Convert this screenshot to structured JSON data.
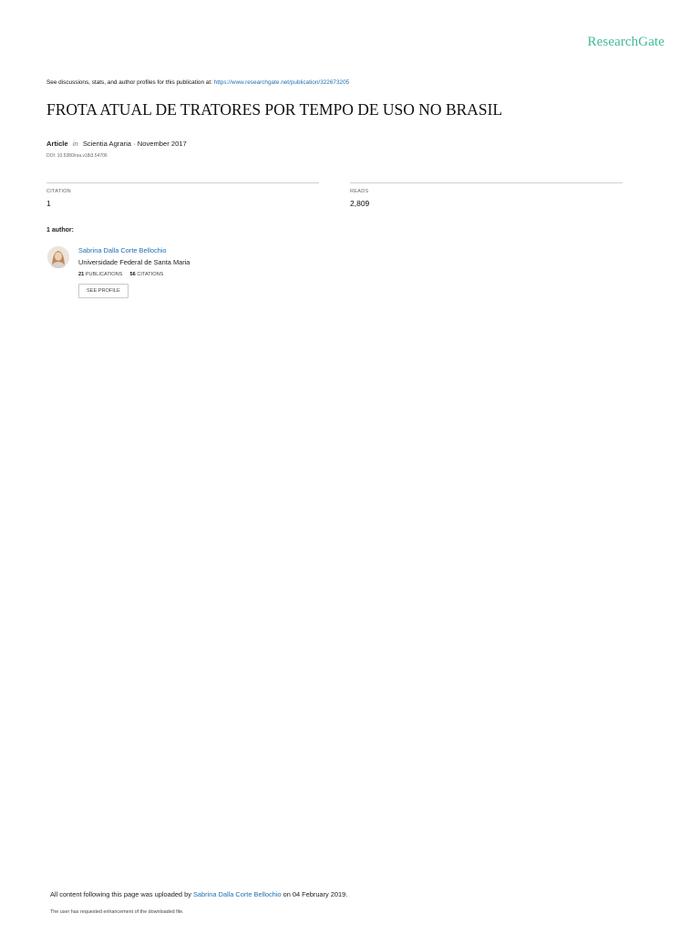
{
  "colors": {
    "brand": "#40ba9b",
    "link": "#1f6fb2"
  },
  "header": {
    "brand": "ResearchGate"
  },
  "notice": {
    "text": "See discussions, stats, and author profiles for this publication at:",
    "url": "https://www.researchgate.net/publication/322673205"
  },
  "article": {
    "title": "FROTA ATUAL DE TRATORES POR TEMPO DE USO NO BRASIL",
    "type": "Article",
    "in_label": "in",
    "journal_date": "Scientia Agraria · November 2017",
    "doi": "DOI: 10.5380/rsa.v18i3.54706"
  },
  "stats": {
    "citation_label": "CITATION",
    "citation_value": "1",
    "reads_label": "READS",
    "reads_value": "2,809"
  },
  "authors": {
    "heading": "1 author:",
    "items": [
      {
        "name": "Sabrina Dalla Corte Bellochio",
        "institution": "Universidade Federal de Santa Maria",
        "publications_count": "21",
        "publications_label": "PUBLICATIONS",
        "citations_count": "56",
        "citations_label": "CITATIONS",
        "profile_button": "SEE PROFILE"
      }
    ]
  },
  "footer": {
    "uploaded_prefix": "All content following this page was uploaded by",
    "uploader": "Sabrina Dalla Corte Bellochio",
    "uploaded_suffix": "on 04 February 2019.",
    "enhancement": "The user has requested enhancement of the downloaded file."
  }
}
